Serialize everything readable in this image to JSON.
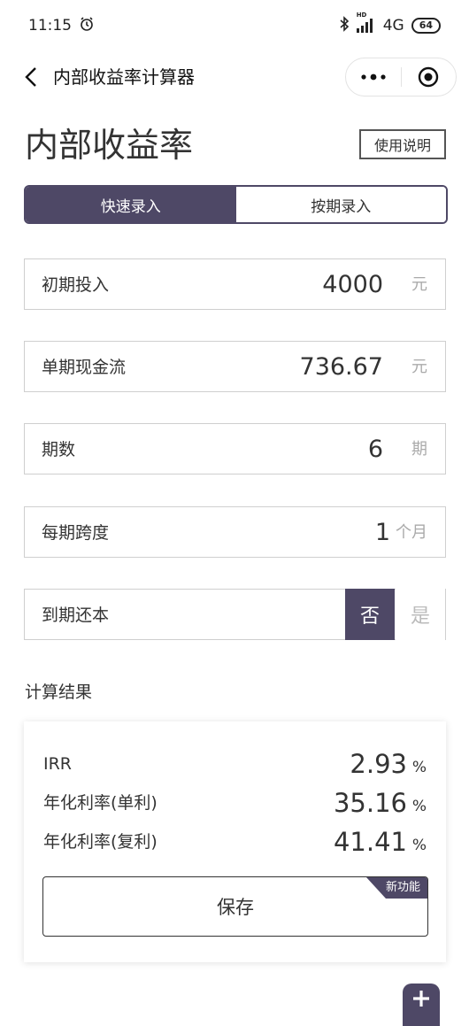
{
  "status_bar": {
    "time": "11:15",
    "network": "4G",
    "battery": "64",
    "hd": "HD"
  },
  "nav": {
    "title": "内部收益率计算器"
  },
  "page": {
    "title": "内部收益率",
    "help_label": "使用说明"
  },
  "tabs": [
    {
      "label": "快速录入",
      "active": true
    },
    {
      "label": "按期录入",
      "active": false
    }
  ],
  "fields": {
    "initial_investment": {
      "label": "初期投入",
      "value": "4000",
      "unit": "元"
    },
    "period_cashflow": {
      "label": "单期现金流",
      "value": "736.67",
      "unit": "元"
    },
    "periods": {
      "label": "期数",
      "value": "6",
      "unit": "期"
    },
    "period_span": {
      "label": "每期跨度",
      "value": "1",
      "unit": "个月"
    },
    "repay_principal": {
      "label": "到期还本",
      "option_no": "否",
      "option_yes": "是",
      "selected": "否"
    }
  },
  "results": {
    "section_title": "计算结果",
    "rows": [
      {
        "label": "IRR",
        "value": "2.93",
        "unit": "%"
      },
      {
        "label": "年化利率(单利)",
        "value": "35.16",
        "unit": "%"
      },
      {
        "label": "年化利率(复利)",
        "value": "41.41",
        "unit": "%"
      }
    ],
    "save_label": "保存",
    "badge": "新功能"
  },
  "colors": {
    "accent": "#4e4866",
    "border": "#cfcfcf",
    "unit_text": "#aaaaaa"
  },
  "icons": {
    "alarm": "alarm-clock-icon",
    "bluetooth": "bluetooth-icon",
    "signal": "signal-icon",
    "back": "chevron-left-icon",
    "more": "more-dots-icon",
    "close": "target-close-icon",
    "add": "plus-icon"
  }
}
